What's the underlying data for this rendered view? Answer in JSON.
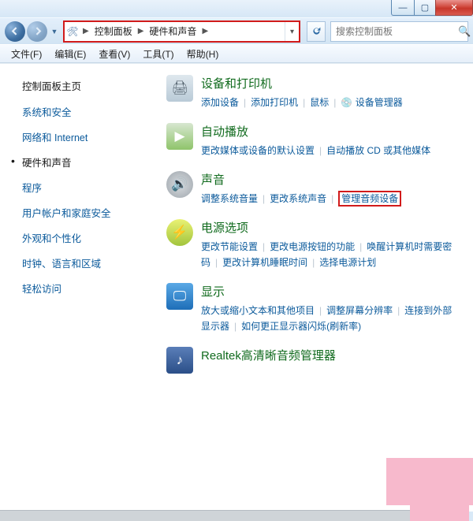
{
  "titlebar": {
    "min": "—",
    "max": "▢",
    "close": "✕"
  },
  "nav": {
    "breadcrumb": [
      "控制面板",
      "硬件和声音"
    ],
    "search_placeholder": "搜索控制面板"
  },
  "menu": [
    {
      "label": "文件(F)"
    },
    {
      "label": "编辑(E)"
    },
    {
      "label": "查看(V)"
    },
    {
      "label": "工具(T)"
    },
    {
      "label": "帮助(H)"
    }
  ],
  "sidebar": {
    "title": "控制面板主页",
    "items": [
      {
        "label": "系统和安全",
        "current": false
      },
      {
        "label": "网络和 Internet",
        "current": false
      },
      {
        "label": "硬件和声音",
        "current": true
      },
      {
        "label": "程序",
        "current": false
      },
      {
        "label": "用户帐户和家庭安全",
        "current": false
      },
      {
        "label": "外观和个性化",
        "current": false
      },
      {
        "label": "时钟、语言和区域",
        "current": false
      },
      {
        "label": "轻松访问",
        "current": false
      }
    ]
  },
  "categories": [
    {
      "icon": "printer",
      "title": "设备和打印机",
      "links": [
        "添加设备",
        "添加打印机",
        "鼠标",
        "💿 设备管理器"
      ]
    },
    {
      "icon": "autoplay",
      "title": "自动播放",
      "links": [
        "更改媒体或设备的默认设置",
        "自动播放 CD 或其他媒体"
      ]
    },
    {
      "icon": "sound",
      "title": "声音",
      "links": [
        "调整系统音量",
        "更改系统声音",
        "管理音频设备"
      ],
      "highlight": 2
    },
    {
      "icon": "power",
      "title": "电源选项",
      "links": [
        "更改节能设置",
        "更改电源按钮的功能",
        "唤醒计算机时需要密码",
        "更改计算机睡眠时间",
        "选择电源计划"
      ]
    },
    {
      "icon": "display",
      "title": "显示",
      "links": [
        "放大或缩小文本和其他项目",
        "调整屏幕分辨率",
        "连接到外部显示器",
        "如何更正显示器闪烁(刷新率)"
      ]
    },
    {
      "icon": "realtek",
      "title": "Realtek高清晰音频管理器",
      "links": []
    }
  ],
  "icon_glyphs": {
    "printer": "🖨",
    "autoplay": "▶",
    "sound": "🔊",
    "power": "⚡",
    "display": "🖵",
    "realtek": "♪"
  }
}
